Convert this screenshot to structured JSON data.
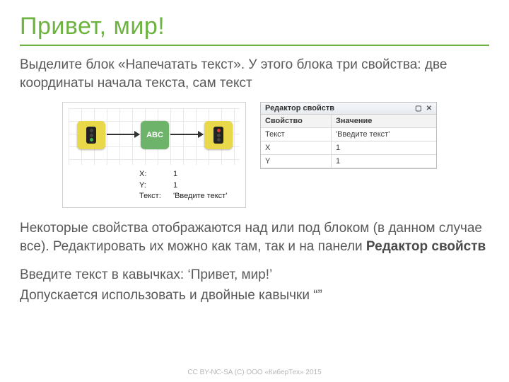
{
  "title": "Привет, мир!",
  "intro": "Выделите блок «Напечатать текст». У этого блока три свойства: две координаты начала текста, сам текст",
  "diagram": {
    "abc_label": "ABC",
    "props": {
      "x_label": "X:",
      "x_val": "1",
      "y_label": "Y:",
      "y_val": "1",
      "t_label": "Текст:",
      "t_val": "'Введите текст'"
    }
  },
  "editor": {
    "title": "Редактор свойств",
    "col1": "Свойство",
    "col2": "Значение",
    "rows": [
      {
        "k": "Текст",
        "v": "'Введите текст'"
      },
      {
        "k": "X",
        "v": "1"
      },
      {
        "k": "Y",
        "v": "1"
      }
    ]
  },
  "mid_a": "Некоторые свойства отображаются над или под блоком (в данном случае все). Редактировать их можно как там, так и на панели ",
  "mid_b": "Редактор свойств",
  "instr1": "Введите текст в кавычках: ‘Привет, мир!’",
  "instr2": "Допускается использовать и двойные кавычки “”",
  "footer": "CC BY-NC-SA (C) ООО «КиберТех» 2015"
}
